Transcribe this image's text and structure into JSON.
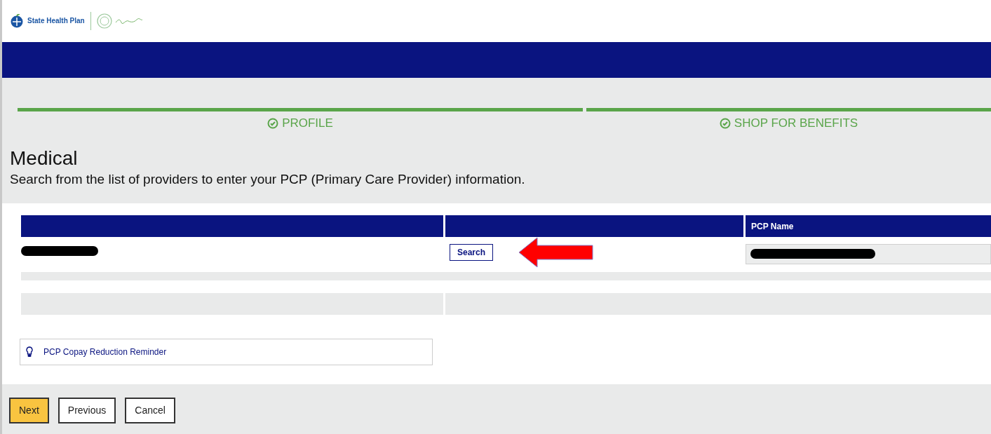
{
  "logo": {
    "name": "State Health Plan"
  },
  "steps": [
    {
      "label": "PROFILE",
      "completed": true
    },
    {
      "label": "SHOP FOR BENEFITS",
      "completed": true
    }
  ],
  "heading": "Medical",
  "instructions": "Search from the list of providers to enter your PCP (Primary Care Provider) information.",
  "table": {
    "columns": [
      "",
      "",
      "PCP Name"
    ],
    "search_button": "Search"
  },
  "reminder": "PCP Copay Reduction Reminder",
  "buttons": [
    {
      "label": "Next",
      "kind": "primary"
    },
    {
      "label": "Previous",
      "kind": "secondary"
    },
    {
      "label": "Cancel",
      "kind": "secondary"
    }
  ]
}
